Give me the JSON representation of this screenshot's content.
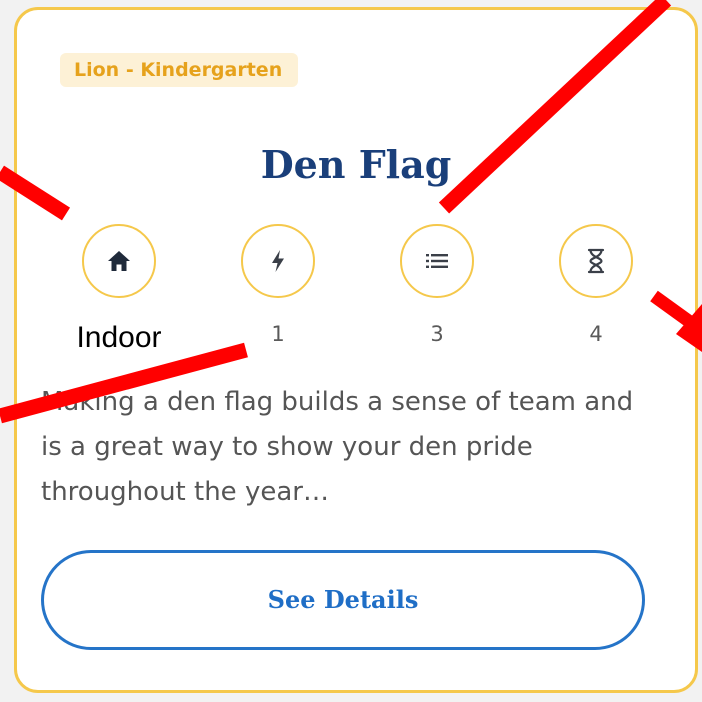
{
  "card": {
    "badge": "Lion - Kindergarten",
    "title": "Den Flag",
    "stats": [
      {
        "icon": "home-icon",
        "value": "Indoor"
      },
      {
        "icon": "lightning-icon",
        "value": "1"
      },
      {
        "icon": "list-icon",
        "value": "3"
      },
      {
        "icon": "hourglass-icon",
        "value": "4"
      }
    ],
    "description": "Making a den flag builds a sense of team and is a great way to show your den pride throughout the year…",
    "button_label": "See Details"
  },
  "colors": {
    "accent": "#f5c84b",
    "title": "#1a3f7a",
    "button": "#2574c8",
    "annotation_arrow": "#ff0000"
  }
}
